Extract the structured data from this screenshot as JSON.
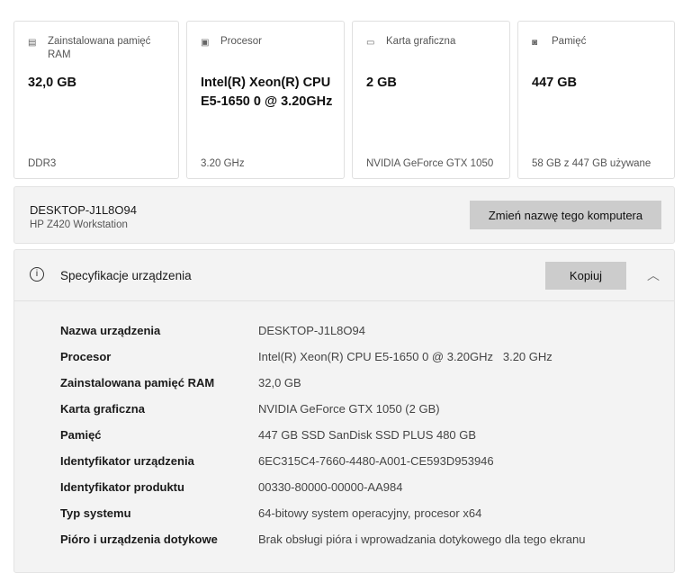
{
  "cards": [
    {
      "icon": "memory-icon",
      "label": "Zainstalowana pamięć RAM",
      "value": "32,0 GB",
      "sub": "DDR3"
    },
    {
      "icon": "processor-icon",
      "label": "Procesor",
      "value": "Intel(R) Xeon(R) CPU E5-1650 0 @ 3.20GHz",
      "sub": "3.20 GHz"
    },
    {
      "icon": "graphics-card-icon",
      "label": "Karta graficzna",
      "value": "2 GB",
      "sub": "NVIDIA GeForce GTX 1050"
    },
    {
      "icon": "storage-icon",
      "label": "Pamięć",
      "value": "447 GB",
      "sub": "58 GB z 447 GB używane"
    }
  ],
  "device": {
    "name": "DESKTOP-J1L8O94",
    "model": "HP Z420 Workstation",
    "rename_label": "Zmień nazwę tego komputera"
  },
  "spec": {
    "title": "Specyfikacje urządzenia",
    "copy_label": "Kopiuj",
    "rows": [
      {
        "k": "Nazwa urządzenia",
        "v": "DESKTOP-J1L8O94"
      },
      {
        "k": "Procesor",
        "v": "Intel(R) Xeon(R) CPU E5-1650 0 @ 3.20GHz   3.20 GHz"
      },
      {
        "k": "Zainstalowana pamięć RAM",
        "v": "32,0 GB"
      },
      {
        "k": "Karta graficzna",
        "v": "NVIDIA GeForce GTX 1050 (2 GB)"
      },
      {
        "k": "Pamięć",
        "v": "447 GB SSD SanDisk SSD PLUS 480 GB"
      },
      {
        "k": "Identyfikator urządzenia",
        "v": "6EC315C4-7660-4480-A001-CE593D953946"
      },
      {
        "k": "Identyfikator produktu",
        "v": "00330-80000-00000-AA984"
      },
      {
        "k": "Typ systemu",
        "v": "64-bitowy system operacyjny, procesor x64"
      },
      {
        "k": "Pióro i urządzenia dotykowe",
        "v": "Brak obsługi pióra i wprowadzania dotykowego dla tego ekranu"
      }
    ]
  }
}
